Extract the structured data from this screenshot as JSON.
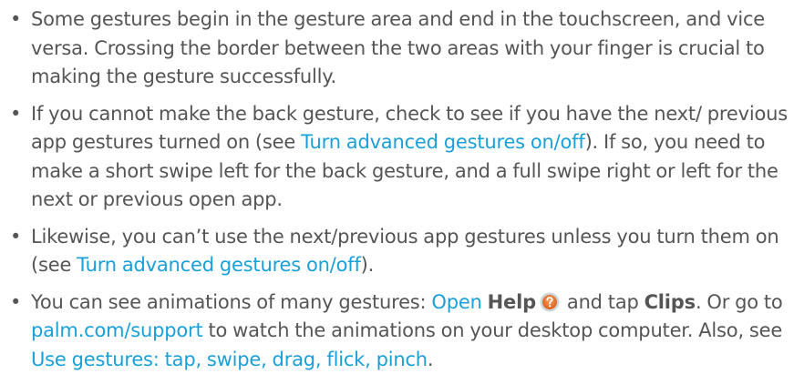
{
  "bullets": {
    "b1": {
      "text": "Some gestures begin in the gesture area and end in the touchscreen, and vice versa. Crossing the border between the two areas with your finger is crucial to making the gesture successfully."
    },
    "b2": {
      "t1": "If you cannot make the back gesture, check to see if you have the next/ previous app gestures turned on (see ",
      "link1": "Turn advanced gestures on/off",
      "t2": "). If so, you need to make a short swipe left for the back gesture, and a full swipe right or left for the next or previous open app."
    },
    "b3": {
      "t1": "Likewise, you can’t use the next/previous app gestures unless you turn them on (see ",
      "link1": "Turn advanced gestures on/off",
      "t2": ")."
    },
    "b4": {
      "t1": "You can see animations of many gestures: ",
      "link_open": "Open",
      "bold_help": "Help",
      "t2": " and tap ",
      "bold_clips": "Clips",
      "t3": ". Or go to ",
      "link_palm": "palm.com/support",
      "t4": " to watch the animations on your desktop computer. Also, see ",
      "link_gestures": "Use gestures: tap, swipe, drag, flick, pinch",
      "t5": "."
    }
  },
  "bullet_glyph": "•",
  "icons": {
    "help": "help-app-icon"
  },
  "colors": {
    "text": "#555555",
    "link": "#1aa0d8",
    "help_icon": "#e8772e"
  }
}
